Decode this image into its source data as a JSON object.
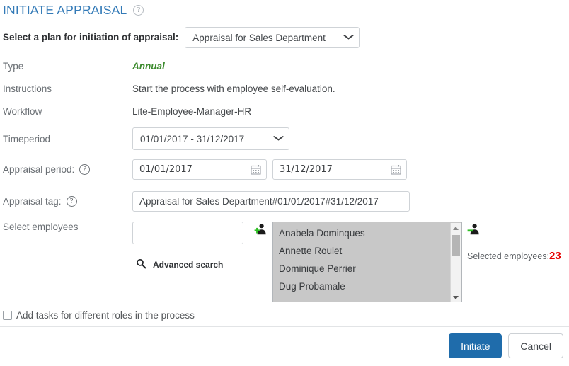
{
  "header": {
    "title": "INITIATE APPRAISAL",
    "help_icon": "help-circle-icon",
    "help_glyph": "?"
  },
  "plan": {
    "label": "Select a plan for initiation of appraisal:",
    "selected": "Appraisal for Sales Department",
    "options": [
      "Appraisal for Sales Department"
    ],
    "caret": "⌄"
  },
  "details": {
    "type_label": "Type",
    "type_value": "Annual",
    "instructions_label": "Instructions",
    "instructions_value": "Start the process with employee self-evaluation.",
    "workflow_label": "Workflow",
    "workflow_value": "Lite-Employee-Manager-HR"
  },
  "timeperiod": {
    "label": "Timeperiod",
    "selected": "01/01/2017 - 31/12/2017",
    "options": [
      "01/01/2017 - 31/12/2017"
    ]
  },
  "appraisal_period": {
    "label": "Appraisal period:",
    "help_glyph": "?",
    "start_date": "01/01/2017",
    "end_date": "31/12/2017",
    "calendar_icon": "calendar-icon"
  },
  "appraisal_tag": {
    "label": "Appraisal tag:",
    "help_glyph": "?",
    "value": "Appraisal for Sales Department#01/01/2017#31/12/2017",
    "placeholder": ""
  },
  "employees": {
    "label": "Select employees",
    "search_value": "",
    "search_placeholder": "",
    "advanced_search_label": "Advanced search",
    "search_icon": "magnifier-icon",
    "add_icon": "user-add-icon",
    "remove_icon": "user-remove-icon",
    "list": [
      "Anabela Dominques",
      "Annette Roulet",
      "Dominique Perrier",
      "Dug Probamale"
    ],
    "selected_count_label": "Selected employees:",
    "selected_count": "23",
    "count_color": "#e60000"
  },
  "options": {
    "add_tasks_label": "Add tasks for different roles in the process",
    "add_tasks_checked": false
  },
  "footer": {
    "initiate_label": "Initiate",
    "cancel_label": "Cancel",
    "primary_color": "#1f6cab"
  }
}
